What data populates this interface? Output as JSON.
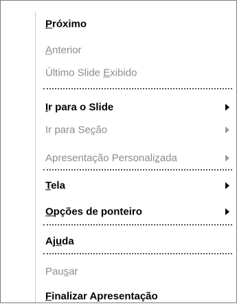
{
  "menu": {
    "items": [
      {
        "pre": "",
        "key": "P",
        "post": "róximo"
      },
      {
        "pre": "",
        "key": "A",
        "post": "nterior"
      },
      {
        "pre": "Último Slide ",
        "key": "E",
        "post": "xibido"
      },
      {
        "pre": "",
        "key": "I",
        "post": "r para o Slide"
      },
      {
        "pre": "Ir para Se",
        "key": "ç",
        "post": "ão"
      },
      {
        "pre": "Apresentação Personali",
        "key": "z",
        "post": "ada"
      },
      {
        "pre": "",
        "key": "T",
        "post": "ela"
      },
      {
        "pre": "",
        "key": "O",
        "post": "pções de ponteiro"
      },
      {
        "pre": "Aj",
        "key": "u",
        "post": "da"
      },
      {
        "pre": "Pau",
        "key": "s",
        "post": "ar"
      },
      {
        "pre": "",
        "key": "F",
        "post": "inalizar Apresentação"
      }
    ]
  }
}
